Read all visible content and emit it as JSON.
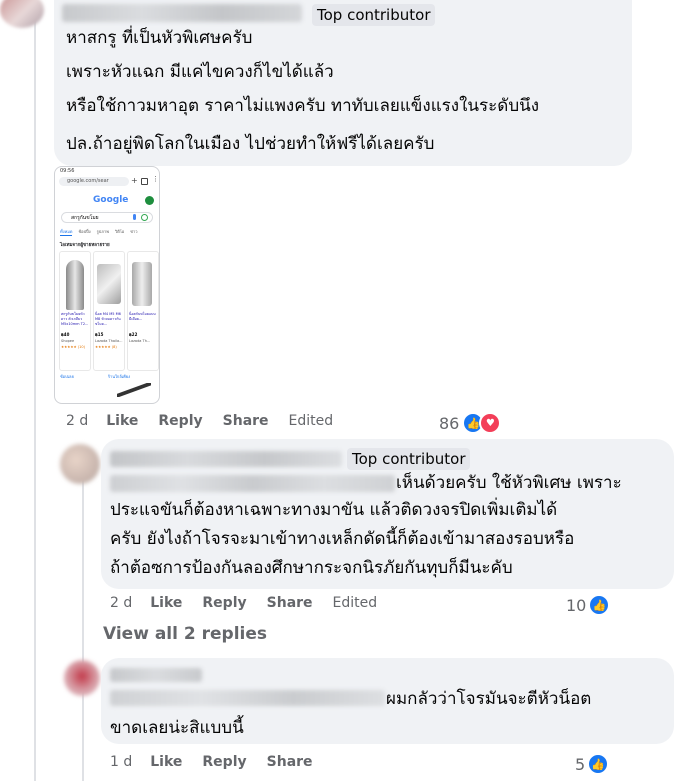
{
  "comment1": {
    "badge": "Top contributor",
    "lines": [
      "หาสกรู ที่เป็นหัวพิเศษครับ",
      "เพราะหัวแฉก มีแค่ไขควงก็ไขได้แล้ว",
      "หรือใช้กาวมหาอุต ราคาไม่แพงครับ ทาทับเลยแข็งแรงในระดับนึง",
      "ปล.ถ้าอยู่พิดโลกในเมือง ไปช่วยทำให้ฟรีได้เลยครับ"
    ],
    "time": "2 d",
    "like": "Like",
    "reply": "Reply",
    "share": "Share",
    "edited": "Edited",
    "reactions": "86"
  },
  "phone": {
    "status": "09:56",
    "url": "google.com/sear",
    "logo": "Google",
    "query": "สกรูกันขโมย",
    "tabs": [
      "ทั้งหมด",
      "ช้อปปิ้ง",
      "รูปภาพ",
      "วิดีโอ",
      "ข่าว"
    ],
    "section": "ไอเทมจากผู้ขายหลายราย",
    "products": [
      {
        "title": "สกรูกันขโมยหัวดาว ตัวเกลียว M5x10mm T2...",
        "price": "฿40",
        "store": "Shopee",
        "rating": "★★★★★ (10)"
      },
      {
        "title": "น็อต M4 M5 M6 M8 หัวจมดาวกันขโมย...",
        "price": "฿15",
        "store": "Lazada Thaila...",
        "rating": "★★★★★ (8)"
      },
      {
        "title": "น็อตกันขโมยแบบมีเดือย...",
        "price": "฿22",
        "store": "Lazada Th...",
        "rating": ""
      }
    ],
    "nearby": [
      "ช้อปเลย",
      "ร้านใกล้เคียง"
    ]
  },
  "comment2": {
    "badge": "Top contributor",
    "lines": [
      "เห็นด้วยครับ ใช้หัวพิเศษ เพราะ",
      "ประแจขันก็ต้องหาเฉพาะทางมาขัน แล้วติดวงจรปิดเพิ่มเติมได้",
      "ครับ ยังไงถ้าโจรจะมาเข้าทางเหล็กดัดนี้ก็ต้องเข้ามาสองรอบหรือ",
      "ถ้าต้อซการป้องกันลองศึกษากระจกนิรภัยกันทุบก็มีนะคับ"
    ],
    "time": "2 d",
    "like": "Like",
    "reply": "Reply",
    "share": "Share",
    "edited": "Edited",
    "reactions": "10"
  },
  "view_replies": "View all 2 replies",
  "comment3": {
    "lines": [
      "ผมกลัวว่าโจรมันจะตีหัวน็อต",
      "ขาดเลยน่ะสิแบบนี้"
    ],
    "time": "1 d",
    "like": "Like",
    "reply": "Reply",
    "share": "Share",
    "reactions": "5"
  },
  "colors": {
    "bubble": "#f0f2f5",
    "badge_bg": "#e4e6eb",
    "meta": "#65676b",
    "like_blue": "#1877f2",
    "love_red": "#f33e58"
  }
}
